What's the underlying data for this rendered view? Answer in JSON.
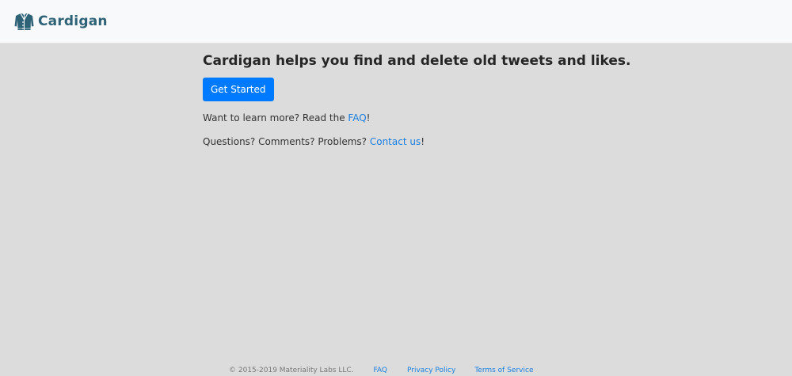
{
  "navbar": {
    "brand_name": "Cardigan",
    "brand_icon": "cardigan-sweater-icon",
    "brand_color": "#2e6276"
  },
  "main": {
    "headline": "Cardigan helps you find and delete old tweets and likes.",
    "get_started_label": "Get Started",
    "learn_more": {
      "prefix": "Want to learn more? Read the ",
      "link_text": "FAQ",
      "suffix": "!"
    },
    "contact": {
      "prefix": "Questions? Comments? Problems? ",
      "link_text": "Contact us",
      "suffix": "!"
    }
  },
  "footer": {
    "copyright": "© 2015-2019 Materiality Labs LLC.",
    "links": [
      "FAQ",
      "Privacy Policy",
      "Terms of Service"
    ]
  },
  "colors": {
    "page_background": "#dcdcdc",
    "navbar_background": "#f8f9fa",
    "primary_button": "#007bff",
    "link": "#1a7fe0"
  }
}
